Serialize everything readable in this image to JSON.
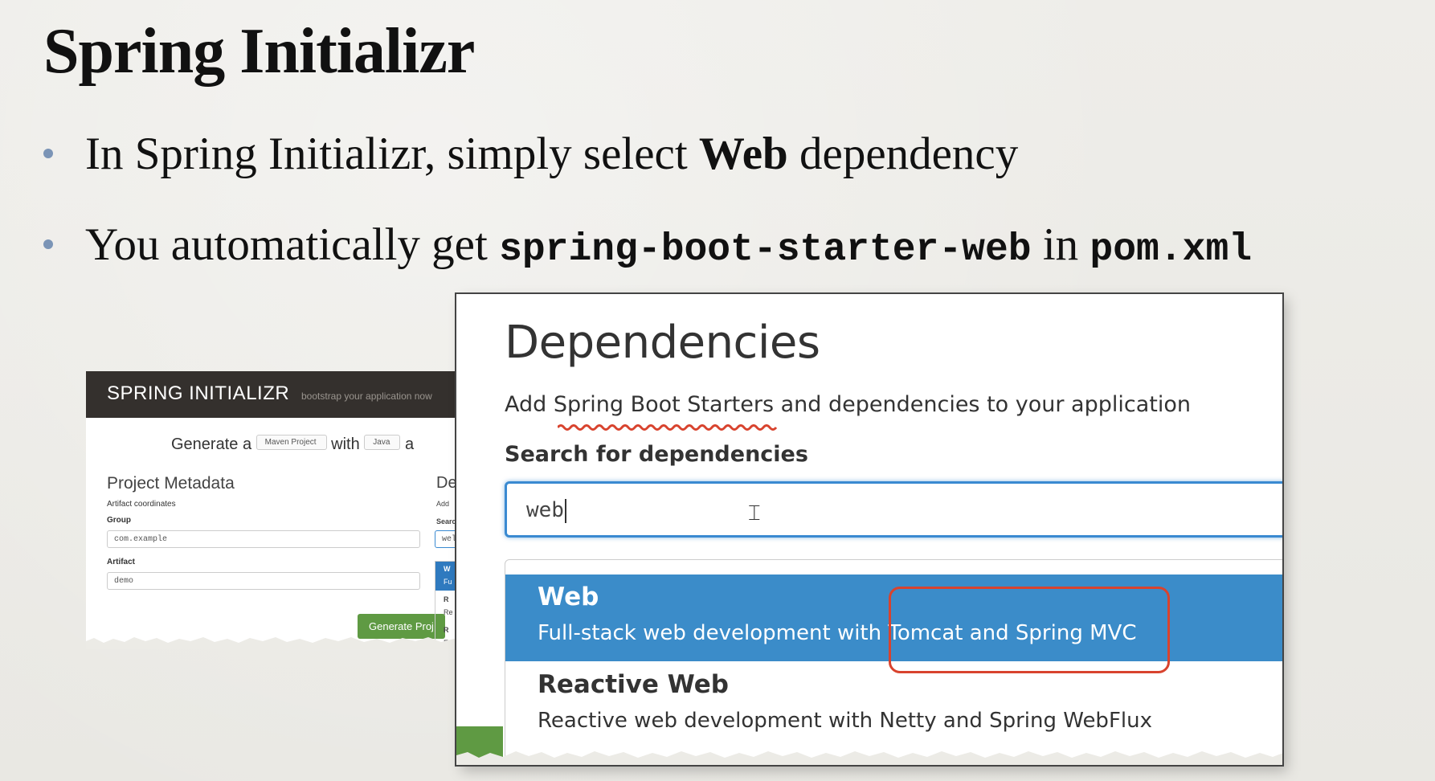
{
  "slide": {
    "title": "Spring Initializr",
    "bullets": [
      {
        "pre": "In Spring Initializr, simply select ",
        "bold": "Web",
        "post": " dependency"
      },
      {
        "pre": "You automatically get ",
        "code1": "spring-boot-starter-web",
        "mid": " in ",
        "code2": "pom.xml"
      }
    ]
  },
  "back_screenshot": {
    "brand": "SPRING INITIALIZR",
    "tagline": "bootstrap your application now",
    "generate_prefix": "Generate a",
    "project_type": "Maven Project",
    "with_label": "with",
    "language": "Java",
    "and_fragment": "a",
    "metadata_title": "Project Metadata",
    "artifact_coords": "Artifact coordinates",
    "group_label": "Group",
    "group_value": "com.example",
    "artifact_label": "Artifact",
    "artifact_value": "demo",
    "generate_button": "Generate Proj",
    "dep_fragment": "De",
    "add_fragment": "Add",
    "search_fragment": "Searc",
    "web_fragment": "wel",
    "list_fragments": [
      "W",
      "Fu",
      "R",
      "Re",
      "R",
      "Ex"
    ]
  },
  "dependencies": {
    "heading": "Dependencies",
    "subtitle": "Add Spring Boot Starters and dependencies to your application",
    "search_label": "Search for dependencies",
    "search_value": "web",
    "results": [
      {
        "name": "Web",
        "description": "Full-stack web development with Tomcat and Spring MVC",
        "selected": true
      },
      {
        "name": "Reactive Web",
        "description": "Reactive web development with Netty and Spring WebFlux",
        "selected": false
      }
    ],
    "colors": {
      "accent": "#3b8cc9",
      "highlight": "#d8432e",
      "brand_green": "#5f9a43"
    }
  }
}
